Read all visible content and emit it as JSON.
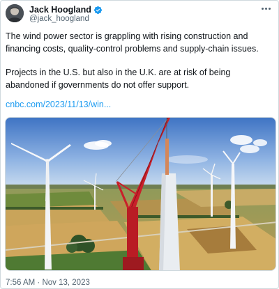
{
  "author": {
    "name": "Jack Hoogland",
    "handle": "@jack_hoogland",
    "verified": true,
    "verified_color": "#1d9bf0"
  },
  "tweet": {
    "paragraph_1": "The wind power sector is grappling with rising construction and financing costs, quality-control problems and supply-chain issues.",
    "paragraph_2": "Projects in the U.S. but also in the U.K. are at risk of being abandoned if governments do not offer support.",
    "link": "cnbc.com/2023/11/13/win..."
  },
  "meta": {
    "time": "7:56 AM",
    "separator": "·",
    "date": "Nov 13, 2023"
  },
  "colors": {
    "link": "#1d9bf0",
    "secondary_text": "#536471",
    "crane": "#c8202a"
  },
  "icons": {
    "verified": "verified-badge-icon",
    "more": "more-options-icon"
  }
}
